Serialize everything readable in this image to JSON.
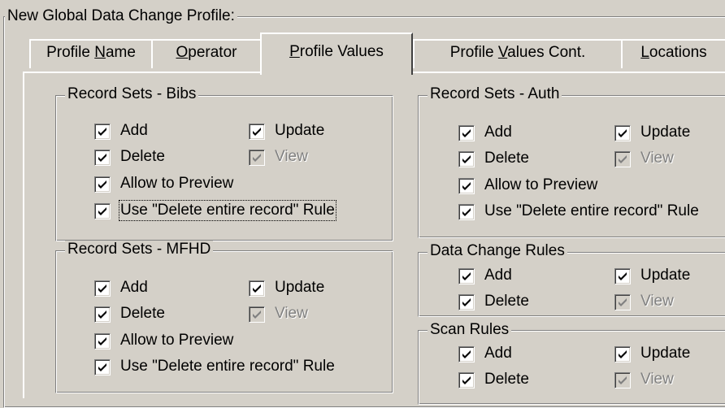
{
  "title": "New  Global Data Change Profile:",
  "tabs": [
    {
      "label_pre": "Profile ",
      "label_ul": "N",
      "label_post": "ame"
    },
    {
      "label_pre": "",
      "label_ul": "O",
      "label_post": "perator"
    },
    {
      "label_pre": "",
      "label_ul": "P",
      "label_post": "rofile Values"
    },
    {
      "label_pre": "Profile ",
      "label_ul": "V",
      "label_post": "alues Cont."
    },
    {
      "label_pre": "",
      "label_ul": "L",
      "label_post": "ocations"
    }
  ],
  "selected_tab": "Profile Values",
  "groups": {
    "bibs": {
      "title": "Record Sets - Bibs",
      "add": "Add",
      "update": "Update",
      "delete": "Delete",
      "view": "View",
      "preview": "Allow to Preview",
      "rule": "Use \"Delete entire record\" Rule",
      "checked": {
        "add": true,
        "update": true,
        "delete": true,
        "view": true,
        "preview": true,
        "rule": true
      }
    },
    "mfhd": {
      "title": "Record Sets - MFHD",
      "add": "Add",
      "update": "Update",
      "delete": "Delete",
      "view": "View",
      "preview": "Allow to Preview",
      "rule": "Use \"Delete entire record\" Rule",
      "checked": {
        "add": true,
        "update": true,
        "delete": true,
        "view": true,
        "preview": true,
        "rule": true
      }
    },
    "auth": {
      "title": "Record Sets - Auth",
      "add": "Add",
      "update": "Update",
      "delete": "Delete",
      "view": "View",
      "preview": "Allow to Preview",
      "rule": "Use \"Delete entire record\" Rule",
      "checked": {
        "add": true,
        "update": true,
        "delete": true,
        "view": true,
        "preview": true,
        "rule": true
      }
    },
    "dcr": {
      "title": "Data Change Rules",
      "add": "Add",
      "update": "Update",
      "delete": "Delete",
      "view": "View",
      "checked": {
        "add": true,
        "update": true,
        "delete": true,
        "view": true
      }
    },
    "scan": {
      "title": "Scan Rules",
      "add": "Add",
      "update": "Update",
      "delete": "Delete",
      "view": "View",
      "checked": {
        "add": true,
        "update": true,
        "delete": true,
        "view": true
      }
    }
  }
}
